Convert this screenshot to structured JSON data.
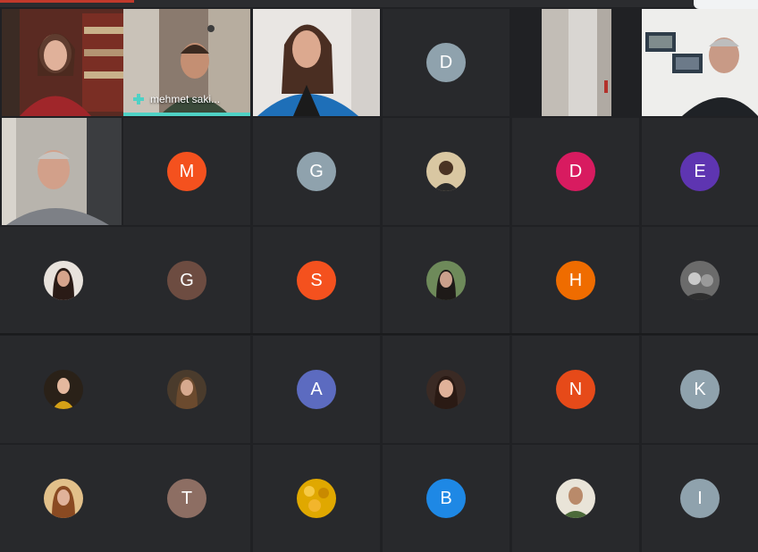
{
  "meeting": {
    "pinned_participant": "mehmet saki...",
    "active_speaker_color": "#4fd1c5"
  },
  "tiles": {
    "r1": [
      {
        "type": "video",
        "icon": "woman-bookshelf-video"
      },
      {
        "type": "video",
        "icon": "man-speaking-video",
        "name": "mehmet saki..."
      },
      {
        "type": "video",
        "icon": "woman-blue-jacket-video"
      },
      {
        "type": "initial",
        "initial": "D",
        "color": "#8fa2ad"
      },
      {
        "type": "video",
        "icon": "curtain-room-video"
      },
      {
        "type": "video",
        "icon": "man-white-wall-video"
      }
    ],
    "r2": [
      {
        "type": "video",
        "icon": "man-grey-shirt-video"
      },
      {
        "type": "initial",
        "initial": "M",
        "color": "#f4511e"
      },
      {
        "type": "initial",
        "initial": "G",
        "color": "#8fa2ad"
      },
      {
        "type": "photo",
        "icon": "profile-photo"
      },
      {
        "type": "initial",
        "initial": "D",
        "color": "#d81b60"
      },
      {
        "type": "initial",
        "initial": "E",
        "color": "#5e35b1"
      }
    ],
    "r3": [
      {
        "type": "photo",
        "icon": "profile-photo"
      },
      {
        "type": "initial",
        "initial": "G",
        "color": "#6d4c41"
      },
      {
        "type": "initial",
        "initial": "S",
        "color": "#f4511e"
      },
      {
        "type": "photo",
        "icon": "profile-photo"
      },
      {
        "type": "initial",
        "initial": "H",
        "color": "#ef6c00"
      },
      {
        "type": "photo",
        "icon": "profile-photo"
      }
    ],
    "r4": [
      {
        "type": "photo",
        "icon": "profile-photo"
      },
      {
        "type": "photo",
        "icon": "profile-photo"
      },
      {
        "type": "initial",
        "initial": "A",
        "color": "#5c6bc0"
      },
      {
        "type": "photo",
        "icon": "profile-photo"
      },
      {
        "type": "initial",
        "initial": "N",
        "color": "#e64a19"
      },
      {
        "type": "initial",
        "initial": "K",
        "color": "#8fa2ad"
      }
    ],
    "r5": [
      {
        "type": "photo",
        "icon": "profile-photo"
      },
      {
        "type": "initial",
        "initial": "T",
        "color": "#8d6e63"
      },
      {
        "type": "photo",
        "icon": "profile-photo"
      },
      {
        "type": "initial",
        "initial": "B",
        "color": "#1e88e5"
      },
      {
        "type": "photo",
        "icon": "profile-photo"
      },
      {
        "type": "initial",
        "initial": "I",
        "color": "#8fa2ad"
      }
    ]
  }
}
